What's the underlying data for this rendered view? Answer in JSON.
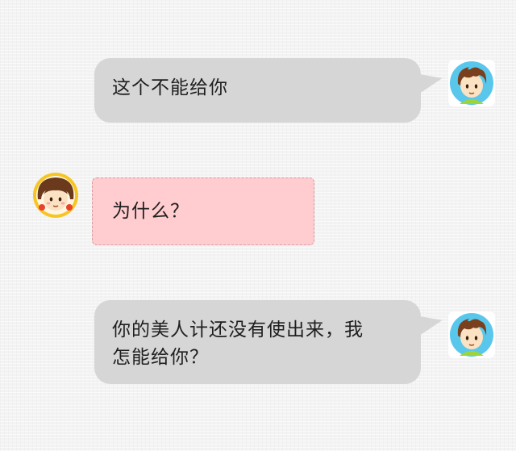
{
  "messages": [
    {
      "sender": "boy",
      "side": "right",
      "text": "这个不能给你"
    },
    {
      "sender": "girl",
      "side": "left",
      "text": "为什么？"
    },
    {
      "sender": "boy",
      "side": "right",
      "lines": [
        "你的美人计还没有使出来，我",
        "怎能给你？"
      ]
    }
  ],
  "colors": {
    "right_bubble": "#d6d6d6",
    "left_bubble": "#ffcccf",
    "left_bubble_border": "#d79ca1",
    "background": "#f3f3f3"
  },
  "icons": {
    "boy": "boy-avatar-icon",
    "girl": "girl-avatar-icon"
  }
}
